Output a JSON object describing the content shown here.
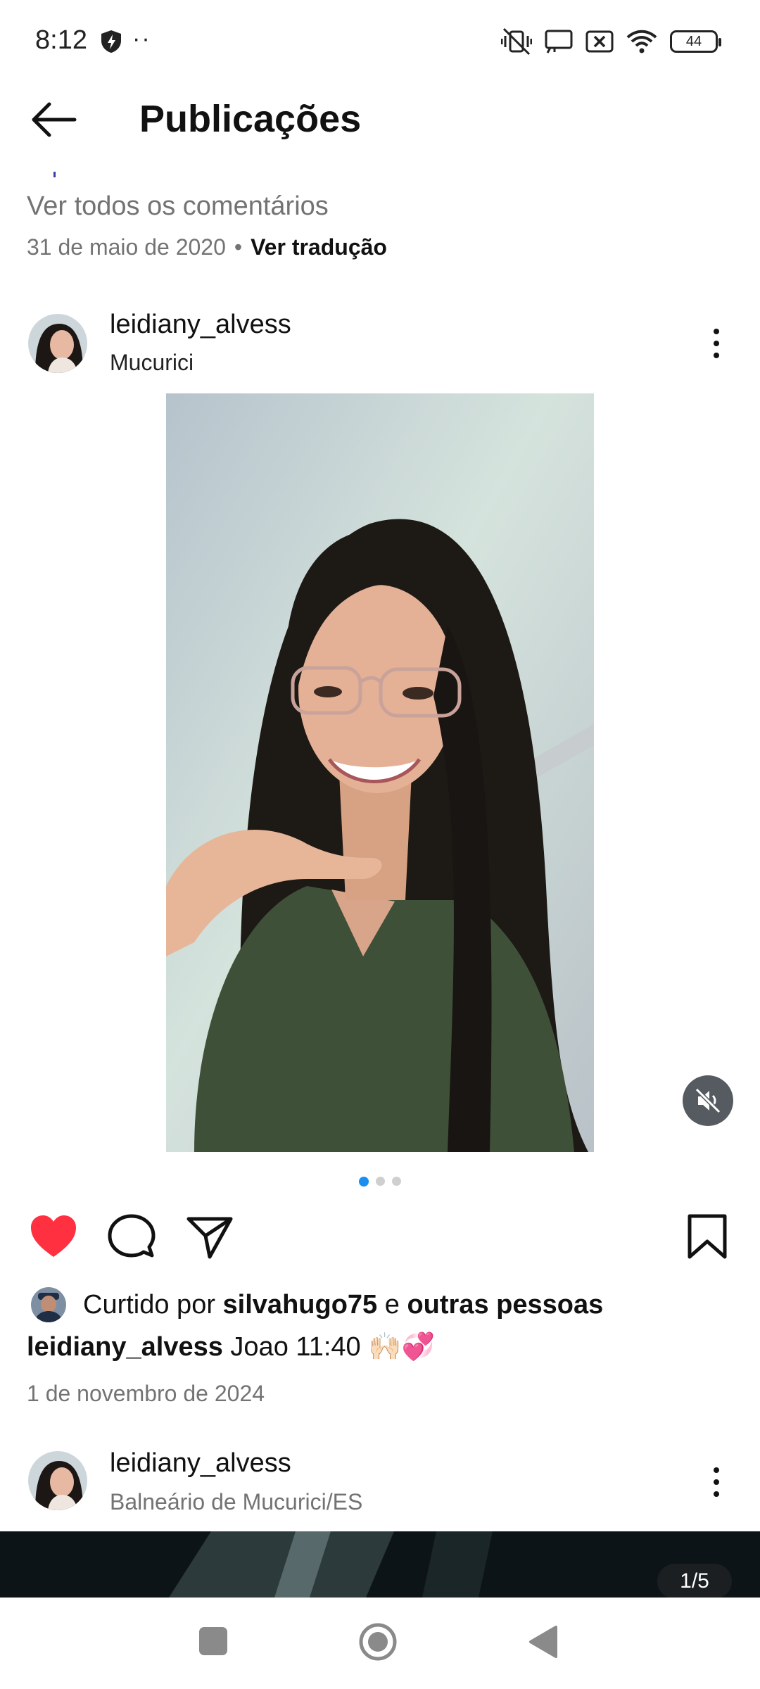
{
  "status_bar": {
    "time": "8:12",
    "dots": "··",
    "battery": "44",
    "icons": [
      "shield-icon",
      "vibrate-off-icon",
      "cast-icon",
      "no-sim-icon",
      "wifi-icon",
      "battery-icon"
    ]
  },
  "header": {
    "title": "Publicações"
  },
  "previous_post": {
    "view_comments": "Ver todos os comentários",
    "date": "31 de maio de 2020",
    "separator": "•",
    "translate": "Ver tradução"
  },
  "post": {
    "username": "leidiany_alvess",
    "location": "Mucurici",
    "carousel_count": 3,
    "carousel_active": 0,
    "liked_by_prefix": "Curtido por",
    "liked_by_user": "silvahugo75",
    "liked_by_connector": "e",
    "liked_by_others": "outras pessoas",
    "caption_user": "leidiany_alvess",
    "caption_text": "Joao 11:40 🙌🏻💞",
    "date": "1 de novembro de 2024",
    "liked": true,
    "like_color": "#ff3040"
  },
  "next_post": {
    "username": "leidiany_alvess",
    "location": "Balneário de Mucurici/ES",
    "counter": "1/5"
  },
  "colors": {
    "accent": "#1a8ff0",
    "secondary_text": "#737373"
  }
}
